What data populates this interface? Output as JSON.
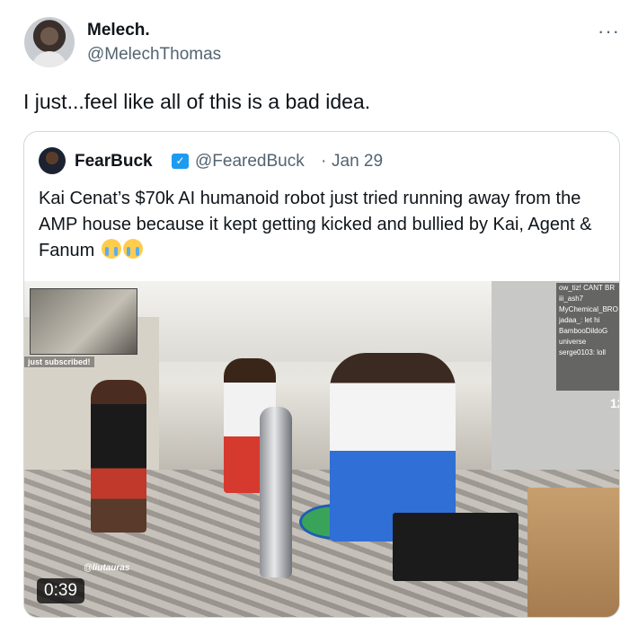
{
  "tweet": {
    "author_name": "Melech.",
    "author_handle": "@MelechThomas",
    "more_icon": "more-horizontal-icon",
    "text": "I just...feel like all of this is a bad idea."
  },
  "quoted_tweet": {
    "author_name": "FearBuck",
    "author_handle": "@FearedBuck",
    "separator": "·",
    "date": "Jan 29",
    "text": "Kai Cenat’s $70k AI humanoid robot just tried running away from the AMP house because it kept getting kicked and bullied by Kai, Agent & Fanum",
    "emojis": [
      "loudly-crying-face",
      "loudly-crying-face"
    ],
    "verified_color": "#1d9bf0",
    "video": {
      "duration": "0:39",
      "overlay_subscribed": "just subscribed!",
      "watermark": "@liutauras",
      "counter": "12",
      "chat_lines": [
        "ow_tiz! CANT BR",
        "iii_ash7",
        "MyChemical_BRO",
        "jadaa_: let hi",
        "BambooDildoG",
        "universe",
        "serge0103: loll"
      ]
    }
  }
}
